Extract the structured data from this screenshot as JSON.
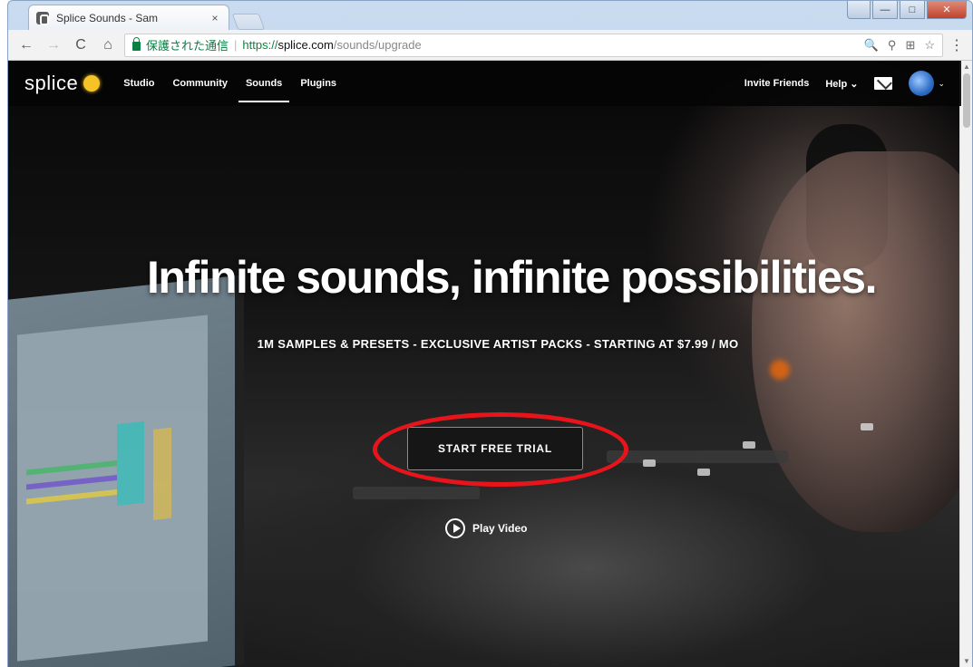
{
  "browser": {
    "tab_title": "Splice Sounds - Sam",
    "tab_close": "×",
    "window_controls": {
      "minimize": "—",
      "maximize": "□",
      "close": "✕"
    },
    "toolbar": {
      "back": "←",
      "forward": "→",
      "reload": "C",
      "home": "⌂",
      "secure_label": "保護された通信",
      "url_scheme": "https://",
      "url_host": "splice.com",
      "url_path": "/sounds/upgrade",
      "right_icons": [
        "🔍",
        "⚲",
        "⊞",
        "☆"
      ],
      "menu": "⋮"
    }
  },
  "site": {
    "logo_text": "splice",
    "nav": [
      "Studio",
      "Community",
      "Sounds",
      "Plugins"
    ],
    "active_nav": "Sounds",
    "nav_right": {
      "invite": "Invite Friends",
      "help": "Help ⌄",
      "avatar_chevron": "⌄"
    }
  },
  "hero": {
    "title": "Infinite sounds, infinite possibilities.",
    "subtitle": "1M SAMPLES & PRESETS - EXCLUSIVE ARTIST PACKS - STARTING AT $7.99 / MO",
    "cta_label": "START FREE TRIAL",
    "play_video_label": "Play Video"
  },
  "colors": {
    "highlight": "#e8141b",
    "logo_badge": "#f5c325",
    "secure_green": "#0b8043"
  },
  "icons": [
    "back-icon",
    "forward-icon",
    "reload-icon",
    "home-icon",
    "lock-icon",
    "zoom-icon",
    "star-icon",
    "menu-icon",
    "mail-icon",
    "play-icon"
  ]
}
